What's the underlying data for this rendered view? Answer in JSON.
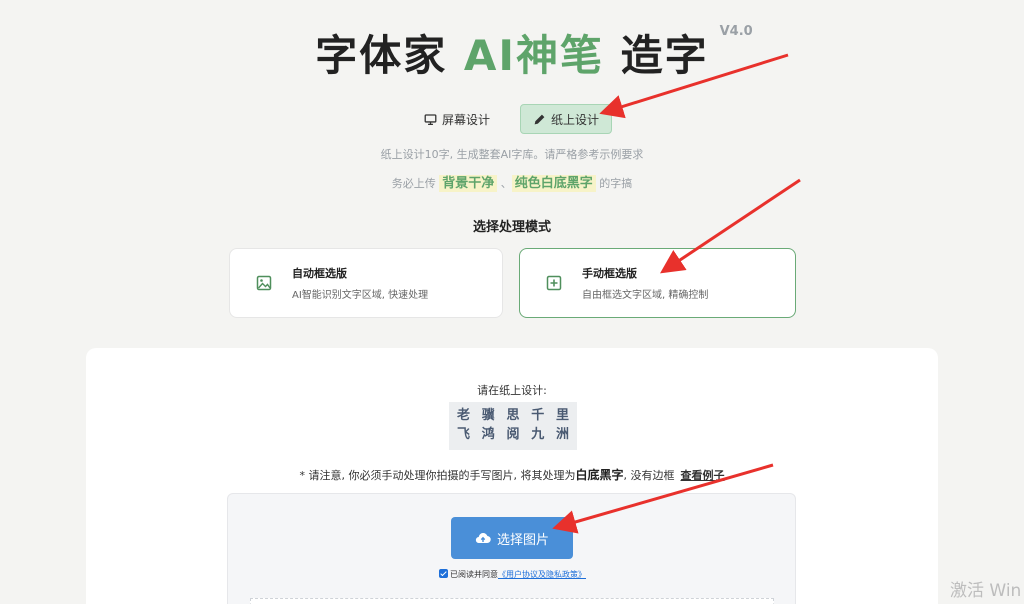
{
  "title": {
    "part1": "字体家 ",
    "accent": "AI神笔",
    "part2": " 造字",
    "version": "V4.0"
  },
  "modes": [
    {
      "label": "屏幕设计",
      "icon": "monitor-icon",
      "active": false
    },
    {
      "label": "纸上设计",
      "icon": "pencil-icon",
      "active": true
    }
  ],
  "hint": {
    "line1": "纸上设计10字, 生成整套AI字库。请严格参考示例要求",
    "line2_pre": "务必上传 ",
    "hl1": "背景干净",
    "sep": " 、",
    "hl2": "纯色白底黑字",
    "line2_post": " 的字搞"
  },
  "section_title": "选择处理模式",
  "options": [
    {
      "title": "自动框选版",
      "sub": "AI智能识别文字区域, 快速处理",
      "icon": "image-icon"
    },
    {
      "title": "手动框选版",
      "sub": "自由框选文字区域, 精确控制",
      "icon": "add-box-icon"
    }
  ],
  "panel": {
    "instruction": "请在纸上设计:",
    "chars_row1": [
      "老",
      "骥",
      "思",
      "千",
      "里"
    ],
    "chars_row2": [
      "飞",
      "鸿",
      "阅",
      "九",
      "洲"
    ],
    "notice_pre": "* 请注意, 你必须手动处理你拍摄的手写图片, 将其处理为",
    "notice_bold": "白底黑字",
    "notice_post": ", 没有边框",
    "notice_link": "查看例子",
    "select_label": "选择图片",
    "agree_text": "已阅读并同意",
    "agree_link": "《用户协议及隐私政策》"
  },
  "watermark": "激活 Win",
  "colors": {
    "accent_green": "#5ea46a",
    "primary_blue": "#4a8fd8",
    "annotation_red": "#e8312c"
  }
}
